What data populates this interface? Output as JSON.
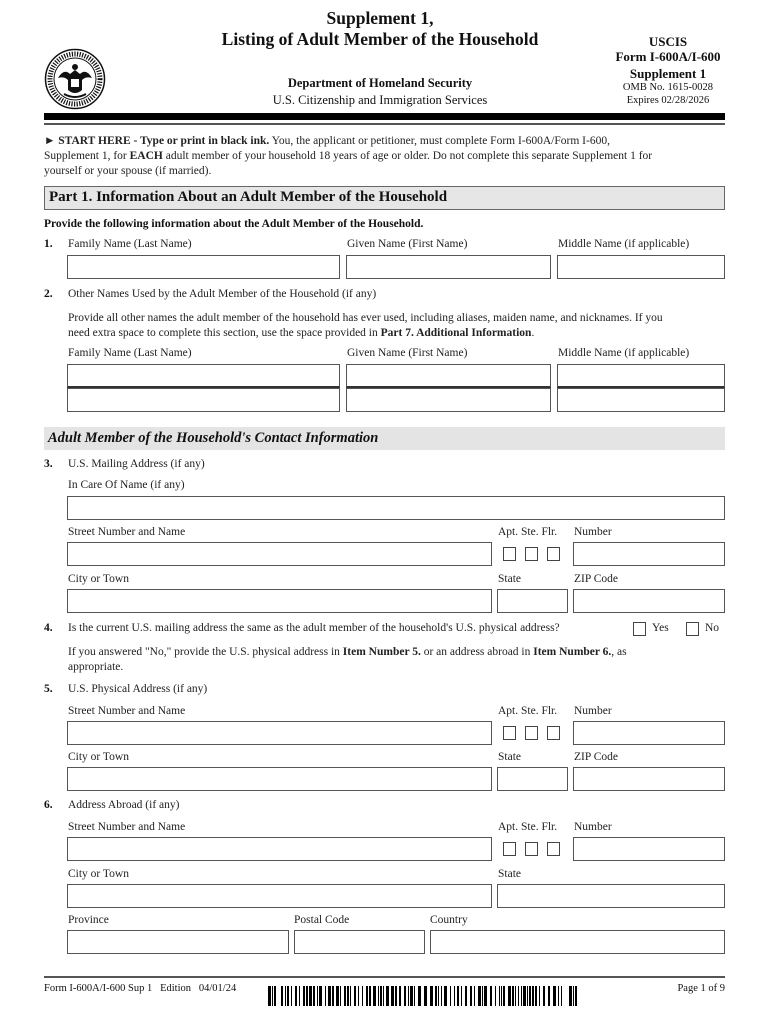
{
  "header": {
    "title_line1": "Supplement 1,",
    "title_line2": "Listing of Adult Member of the Household",
    "department": "Department of Homeland Security",
    "agency": "U.S. Citizenship and Immigration Services",
    "right_agency": "USCIS",
    "right_form": "Form I-600A/I-600",
    "right_supplement": "Supplement 1",
    "omb": "OMB No. 1615-0028",
    "expires": "Expires 02/28/2026",
    "seal_icon": "dhs-seal-icon"
  },
  "intro": {
    "arrow": "►",
    "start_here": "START HERE - Type or print in black ink.",
    "text1": "  You, the applicant or petitioner, must complete Form I-600A/Form I-600,",
    "text2a": "Supplement 1, for ",
    "each": "EACH",
    "text2b": " adult member of your household 18 years of age or older.  Do not complete this separate Supplement 1 for",
    "text3": "yourself or your spouse (if married)."
  },
  "part1": {
    "title": "Part 1.  Information About an Adult Member of the Household",
    "instruction": "Provide the following information about the Adult Member of the Household.",
    "item1": {
      "num": "1.",
      "family": "Family Name (Last Name)",
      "given": "Given Name (First Name)",
      "middle": "Middle Name (if applicable)",
      "values": {
        "family": "",
        "given": "",
        "middle": ""
      }
    },
    "item2": {
      "num": "2.",
      "label": "Other Names Used by the Adult Member of the Household (if any)",
      "desc1": "Provide all other names the adult member of the household has ever used, including aliases, maiden name, and nicknames.  If you",
      "desc2a": "need extra space to complete this section, use the space provided in ",
      "desc2b": "Part 7. Additional Information",
      "desc2c": ".",
      "family": "Family Name (Last Name)",
      "given": "Given Name (First Name)",
      "middle": "Middle Name (if applicable)"
    }
  },
  "contact": {
    "title": "Adult Member of the Household's Contact Information",
    "item3": {
      "num": "3.",
      "label": "U.S. Mailing Address (if any)",
      "care_of": "In Care Of Name (if any)",
      "street": "Street Number and Name",
      "apt": "Apt. Ste. Flr.",
      "number": "Number",
      "city": "City or Town",
      "state": "State",
      "zip": "ZIP Code"
    },
    "item4": {
      "num": "4.",
      "question": "Is the current U.S. mailing address the same as the adult member of the household's U.S. physical address?",
      "yes": "Yes",
      "no": "No",
      "note1a": "If you answered \"No,\" provide the U.S. physical address in ",
      "note1b": "Item Number 5.",
      "note1c": " or an address abroad in ",
      "note1d": "Item Number 6.",
      "note1e": ", as",
      "note2": "appropriate."
    },
    "item5": {
      "num": "5.",
      "label": "U.S. Physical Address (if any)",
      "street": "Street Number and Name",
      "apt": "Apt. Ste. Flr.",
      "number": "Number",
      "city": "City or Town",
      "state": "State",
      "zip": "ZIP Code"
    },
    "item6": {
      "num": "6.",
      "label": "Address Abroad (if any)",
      "street": "Street Number and Name",
      "apt": "Apt. Ste. Flr.",
      "number": "Number",
      "city": "City or Town",
      "state": "State",
      "province": "Province",
      "postal": "Postal Code",
      "country": "Country"
    }
  },
  "footer": {
    "form_id": "Form I-600A/I-600 Sup 1",
    "edition_label": "Edition",
    "edition_date": "04/01/24",
    "page": "Page 1 of 9",
    "barcode_icon": "barcode-icon"
  }
}
